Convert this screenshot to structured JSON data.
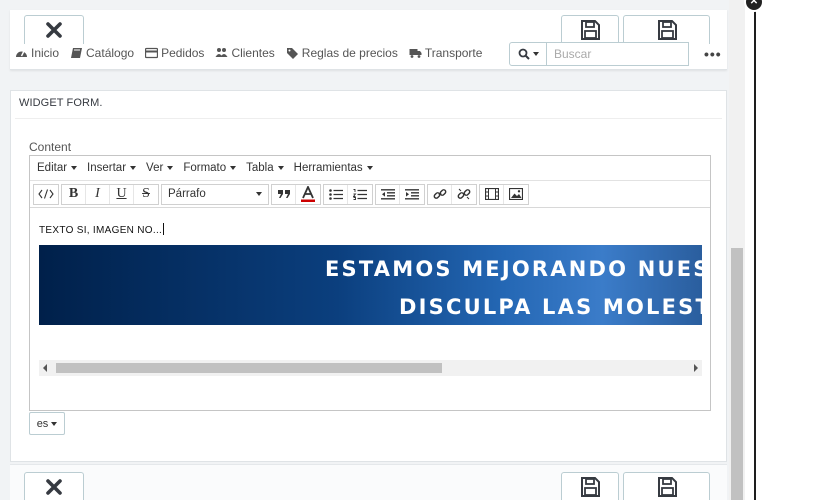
{
  "nav": {
    "items": [
      {
        "label": "Inicio",
        "icon": "dashboard-icon"
      },
      {
        "label": "Catálogo",
        "icon": "book-icon"
      },
      {
        "label": "Pedidos",
        "icon": "credit-card-icon"
      },
      {
        "label": "Clientes",
        "icon": "users-icon"
      },
      {
        "label": "Reglas de precios",
        "icon": "tags-icon"
      },
      {
        "label": "Transporte",
        "icon": "truck-icon"
      }
    ]
  },
  "search": {
    "placeholder": "Buscar"
  },
  "panel": {
    "heading": "WIDGET FORM."
  },
  "field": {
    "label": "Content"
  },
  "editor": {
    "menu": [
      "Editar",
      "Insertar",
      "Ver",
      "Formato",
      "Tabla",
      "Herramientas"
    ],
    "format_select": "Párrafo",
    "body_text": "TEXTO SI, IMAGEN NO...",
    "banner_line1": "ESTAMOS MEJORANDO NUES",
    "banner_line2": "DISCULPA LAS MOLEST"
  },
  "language": {
    "selected": "es"
  },
  "colors": {
    "border": "#bbcdd2",
    "banner": "#0b3f7e",
    "background": "#f1f3f5"
  }
}
